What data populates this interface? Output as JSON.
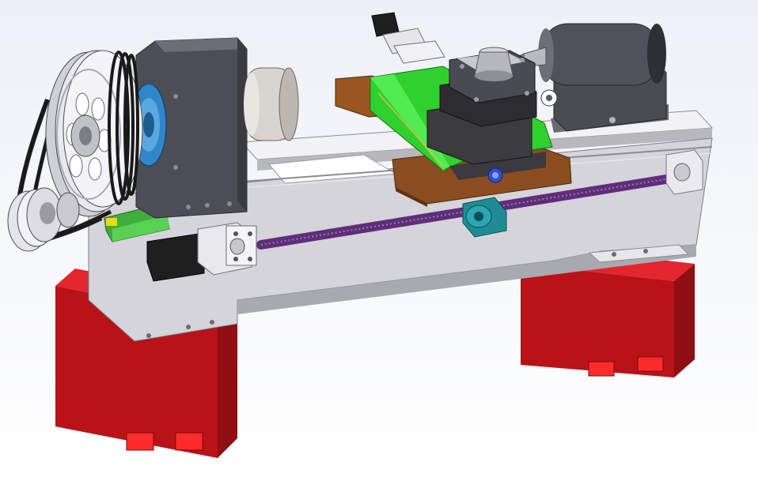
{
  "scene": {
    "colors": {
      "background_top": "#eef0f7",
      "background_bottom": "#ffffff",
      "bed_body": "#cfcfd4",
      "bed_top": "#f4f4f6",
      "legs": "#c4161c",
      "leg_slots": "#e51b24",
      "headstock": "#4d4d55",
      "pulley": "#e8e8ee",
      "belts": "#1a1a1a",
      "motor_flange": "#2f86c8",
      "chuck_motor": "#d7d4cf",
      "carriage": "#8a4d1f",
      "cross_slide": "#2fd12f",
      "tool_post": "#3b3b40",
      "tailstock": "#4b4b52",
      "lead_screw": "#5e2e77",
      "nut_bracket": "#1f8c94",
      "guard": "#4fc548",
      "stepper": "#1f1f1f"
    }
  }
}
